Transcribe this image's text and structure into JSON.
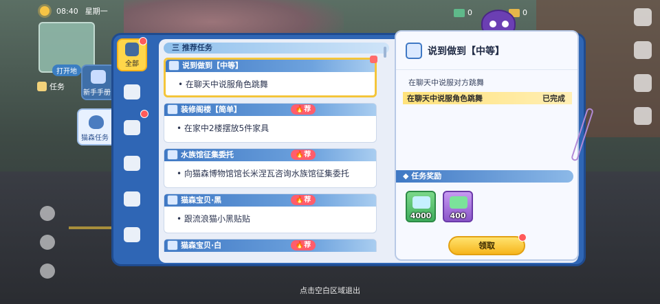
{
  "hud": {
    "time": "08:40",
    "weekday": "星期一",
    "minimap_label": "打开地",
    "task_button": "任务",
    "currency_a": "0",
    "currency_b": "0"
  },
  "side_tabs": {
    "newbie": "新手手册",
    "cat_task": "猫森任务"
  },
  "categories": [
    {
      "label": "全部",
      "active": true
    },
    {
      "label": "",
      "active": false
    },
    {
      "label": "",
      "active": false
    },
    {
      "label": "",
      "active": false
    },
    {
      "label": "",
      "active": false
    },
    {
      "label": "",
      "active": false
    }
  ],
  "list": {
    "header": "三 推荐任务",
    "quests": [
      {
        "title": "说到做到【中等】",
        "desc": "在聊天中说服角色跳舞",
        "tag": "",
        "selected": true
      },
      {
        "title": "装修阁楼【简单】",
        "desc": "在家中2楼摆放5件家具",
        "tag": "荐"
      },
      {
        "title": "水族馆征集委托",
        "desc": "向猫森博物馆馆长米涅瓦咨询水族馆征集委托",
        "tag": "荐"
      },
      {
        "title": "猫森宝贝·黑",
        "desc": "跟流浪猫小黑贴贴",
        "tag": "荐"
      },
      {
        "title": "猫森宝贝·白",
        "desc": "",
        "tag": "荐"
      }
    ]
  },
  "detail": {
    "title": "说到做到【中等】",
    "subtitle": "在聊天中说服对方跳舞",
    "objective": "在聊天中说服角色跳舞",
    "status": "已完成",
    "reward_header": "任务奖励",
    "rewards": [
      {
        "amount": "4000",
        "color": "green",
        "icon": "ticket-icon"
      },
      {
        "amount": "400",
        "color": "purple",
        "icon": "cash-icon"
      }
    ],
    "claim": "领取"
  },
  "exit_hint": "点击空白区域退出"
}
